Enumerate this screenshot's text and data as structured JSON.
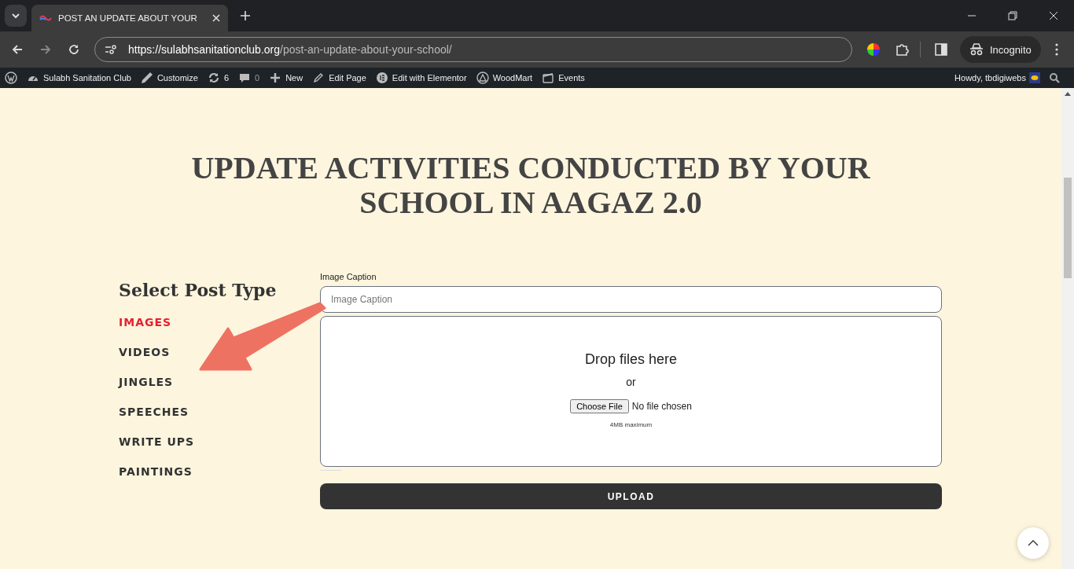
{
  "browser": {
    "tab": {
      "title": "POST AN UPDATE ABOUT YOUR",
      "selected": true
    },
    "url": {
      "host": "https://sulabhsanitationclub.org",
      "path": "/post-an-update-about-your-school/"
    },
    "profile": "Incognito"
  },
  "admin_bar": {
    "items": [
      {
        "label": "Sulabh Sanitation Club"
      },
      {
        "label": "Customize"
      },
      {
        "label": "6"
      },
      {
        "label": "0"
      },
      {
        "label": "New"
      },
      {
        "label": "Edit Page"
      },
      {
        "label": "Edit with Elementor"
      },
      {
        "label": "WoodMart"
      },
      {
        "label": "Events"
      }
    ],
    "greeting": "Howdy, tbdigiwebs"
  },
  "page_title": "UPDATE ACTIVITIES CONDUCTED BY YOUR SCHOOL IN AAGAZ 2.0",
  "sidebar": {
    "heading": "Select Post Type",
    "items": [
      {
        "label": "IMAGES",
        "selected": true
      },
      {
        "label": "VIDEOS",
        "selected": false
      },
      {
        "label": "JINGLES",
        "selected": false
      },
      {
        "label": "SPEECHES",
        "selected": false
      },
      {
        "label": "WRITE UPS",
        "selected": false
      },
      {
        "label": "PAINTINGS",
        "selected": false
      }
    ]
  },
  "form": {
    "caption_label": "Image Caption",
    "caption_placeholder": "Image Caption",
    "dropzone": {
      "heading": "Drop files here",
      "or": "or",
      "choose_button": "Choose File",
      "file_status": "No file chosen",
      "limit": "4MB maximum"
    },
    "upload_button": "UPLOAD"
  }
}
